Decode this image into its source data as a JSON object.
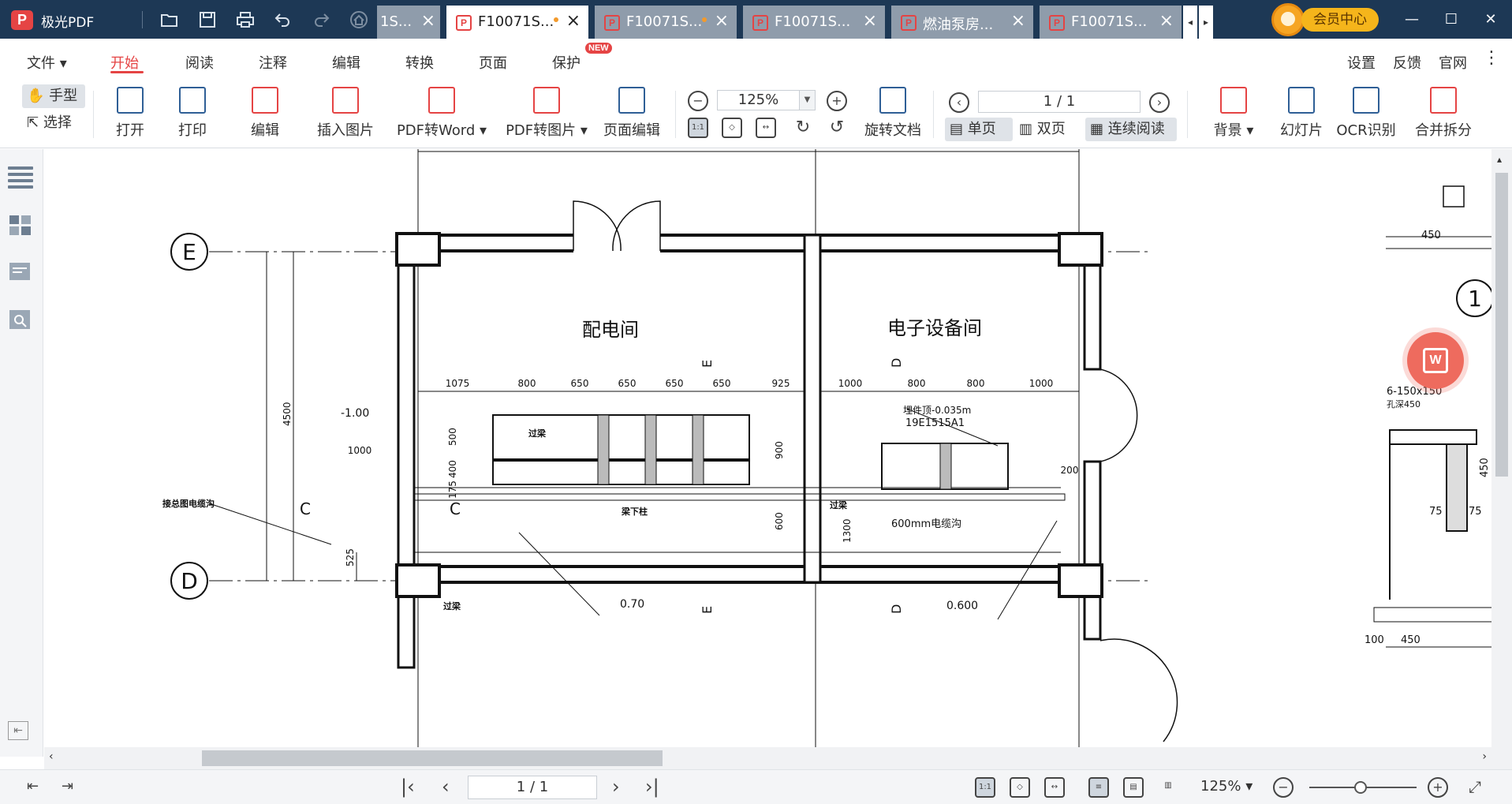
{
  "app": {
    "logo": "P",
    "name": "极光PDF"
  },
  "tabs": [
    {
      "label": "1S...",
      "partial": true
    },
    {
      "label": "F10071S...",
      "active": true,
      "modified": true
    },
    {
      "label": "F10071S...",
      "modified": true
    },
    {
      "label": "F10071S..."
    },
    {
      "label": "燃油泵房..."
    },
    {
      "label": "F10071S..."
    }
  ],
  "vip": {
    "label": "会员中心"
  },
  "menu": {
    "items": [
      "文件",
      "开始",
      "阅读",
      "注释",
      "编辑",
      "转换",
      "页面",
      "保护"
    ],
    "active": "开始",
    "new_badge": "NEW",
    "right": [
      "设置",
      "反馈",
      "官网"
    ]
  },
  "toolbar": {
    "hand": "手型",
    "select": "选择",
    "open": "打开",
    "print": "打印",
    "edit": "编辑",
    "insert_image": "插入图片",
    "pdf_to_word": "PDF转Word",
    "pdf_to_image": "PDF转图片",
    "page_edit": "页面编辑",
    "zoom": "125%",
    "rotate_doc": "旋转文档",
    "page_number": "1 / 1",
    "single_page": "单页",
    "double_page": "双页",
    "continuous": "连续阅读",
    "background": "背景",
    "slideshow": "幻灯片",
    "ocr": "OCR识别",
    "merge_split": "合并拆分",
    "fit_actual": "1:1"
  },
  "drawing": {
    "axis_e": "E",
    "axis_d": "D",
    "axis_1": "1",
    "room_left": "配电间",
    "room_right": "电子设备间",
    "dims_left": [
      "1075",
      "800",
      "650",
      "650",
      "650",
      "650",
      "925"
    ],
    "dims_right": [
      "1000",
      "800",
      "800",
      "1000"
    ],
    "dim_4500": "4500",
    "dim_1000": "1000",
    "dim_525": "525",
    "dim_500": "500",
    "dim_400": "400",
    "dim_175": "175",
    "dim_900": "900",
    "dim_600": "600",
    "dim_1300": "1300",
    "dim_200": "200",
    "level_minus": "-1.00",
    "level_070": "0.70",
    "level_0600": "0.600",
    "note_cable": "接总图电缆沟",
    "note_beam": "过梁",
    "note_beam2": "过梁",
    "note_beam3": "过梁",
    "note_column": "梁下柱",
    "note_embed": "埋件顶-0.035m",
    "note_std": "19E1515A1",
    "note_trench": "600mm电缆沟",
    "section_c": "C",
    "section_c2": "C",
    "section_e": "E",
    "section_d": "D",
    "detail_holes": "6-150x150",
    "detail_depth": "孔深450",
    "detail_450": "450",
    "detail_75a": "75",
    "detail_75b": "75",
    "detail_100": "100",
    "detail_450b": "450",
    "detail_450c": "450",
    "detail_450side": "450"
  },
  "float_button": {
    "label": "W"
  },
  "status": {
    "page": "1 / 1",
    "zoom": "125%"
  },
  "colors": {
    "titlebar": "#1d3855",
    "accent": "#e54444",
    "vip": "#f5b51b",
    "float": "#ee6b5e"
  }
}
